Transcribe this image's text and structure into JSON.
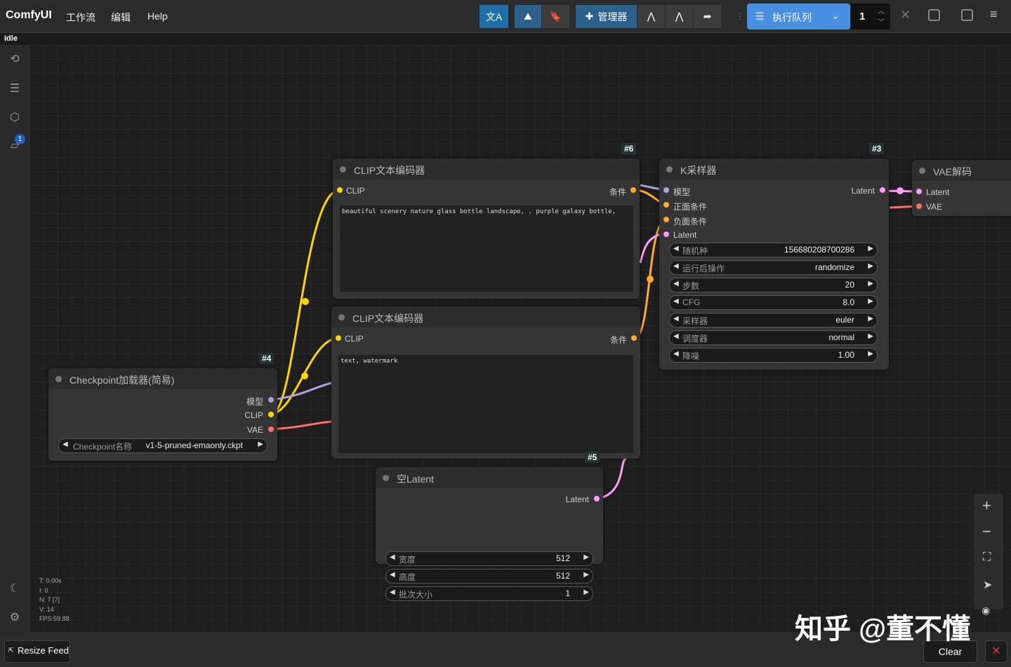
{
  "app": {
    "title": "ComfyUI",
    "status": "Idle"
  },
  "menu": {
    "workflow": "工作流",
    "edit": "编辑",
    "help": "Help"
  },
  "toolbar": {
    "manager": "管理器",
    "queue": "执行队列",
    "queue_count": "1"
  },
  "nodes": {
    "clip1": {
      "id": "#6",
      "title": "CLIP文本编码器",
      "in": "CLIP",
      "out": "条件",
      "text": "beautiful scenery nature glass bottle landscape, , purple galaxy bottle,"
    },
    "clip2": {
      "id": "",
      "title": "CLIP文本编码器",
      "in": "CLIP",
      "out": "条件",
      "text": "text, watermark"
    },
    "ckpt": {
      "id": "#4",
      "title": "Checkpoint加载器(简易)",
      "out_model": "模型",
      "out_clip": "CLIP",
      "out_vae": "VAE",
      "w_label": "Checkpoint名称",
      "w_value": "v1-5-pruned-emaonly.ckpt"
    },
    "ksampler": {
      "id": "#3",
      "title": "K采样器",
      "in_model": "模型",
      "in_pos": "正面条件",
      "in_neg": "负面条件",
      "in_latent": "Latent",
      "out": "Latent",
      "widgets": [
        {
          "l": "随机种",
          "v": "156680208700286"
        },
        {
          "l": "运行后操作",
          "v": "randomize"
        },
        {
          "l": "步数",
          "v": "20"
        },
        {
          "l": "CFG",
          "v": "8.0"
        },
        {
          "l": "采样器",
          "v": "euler"
        },
        {
          "l": "调度器",
          "v": "normal"
        },
        {
          "l": "降噪",
          "v": "1.00"
        }
      ]
    },
    "vae": {
      "title": "VAE解码",
      "in_latent": "Latent",
      "in_vae": "VAE"
    },
    "latent": {
      "id": "#5",
      "title": "空Latent",
      "out": "Latent",
      "widgets": [
        {
          "l": "宽度",
          "v": "512"
        },
        {
          "l": "高度",
          "v": "512"
        },
        {
          "l": "批次大小",
          "v": "1"
        }
      ]
    }
  },
  "stats": {
    "t": "T: 0.00s",
    "i": "I: 0",
    "n": "N: 7 [7]",
    "v": "V: 14",
    "fps": "FPS:59.88"
  },
  "badge": "1",
  "bottom": {
    "resize": "Resize Feed",
    "clear": "Clear"
  },
  "watermark": "知乎 @董不懂",
  "colors": {
    "clip": "#ffd500",
    "model": "#b39ddb",
    "vae": "#ff6e6e",
    "latent": "#ff9cf9",
    "cond": "#ffa931",
    "accent": "#4a90e2"
  }
}
